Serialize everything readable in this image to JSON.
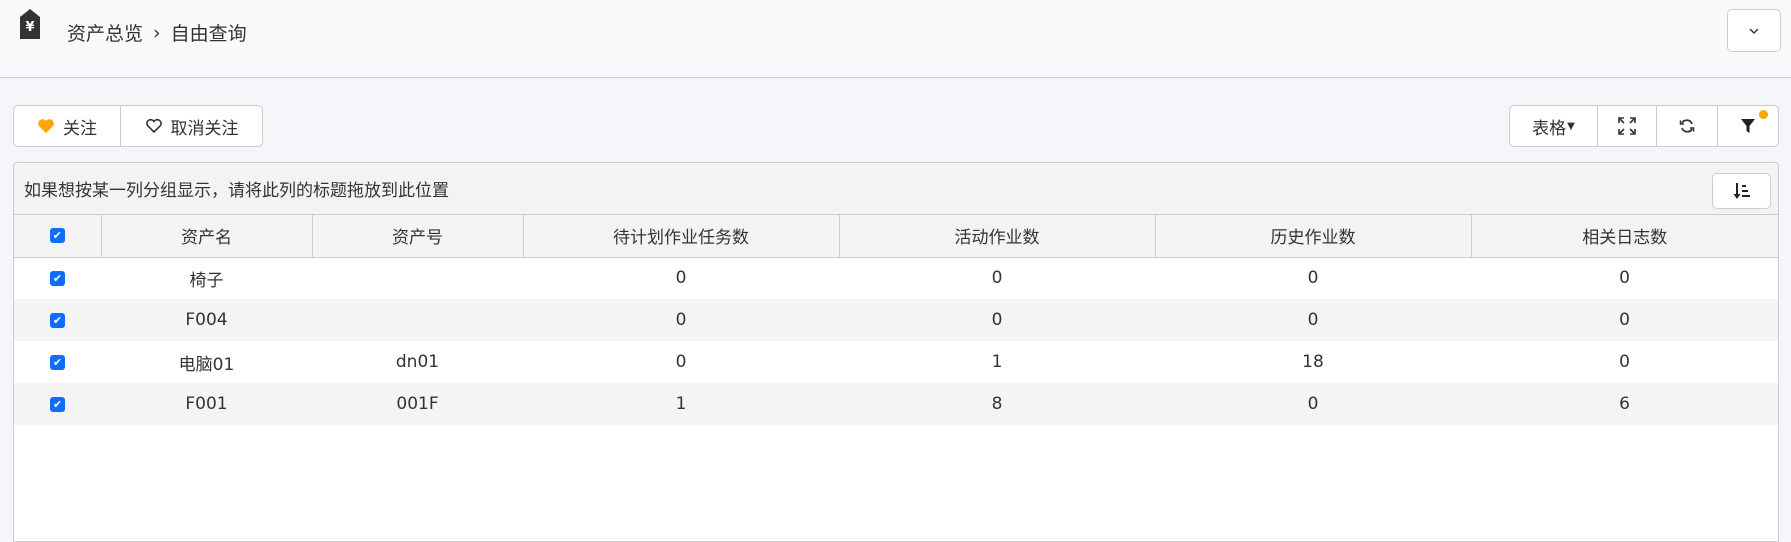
{
  "header": {
    "breadcrumb": [
      "资产总览",
      "自由查询"
    ],
    "separator": "›",
    "dropdown_icon": "chevron-down-icon"
  },
  "actions": {
    "follow": "关注",
    "unfollow": "取消关注",
    "view_mode": "表格",
    "follow_color": "#ffa500"
  },
  "grid": {
    "group_hint": "如果想按某一列分组显示，请将此列的标题拖放到此位置",
    "columns": [
      "资产名",
      "资产号",
      "待计划作业任务数",
      "活动作业数",
      "历史作业数",
      "相关日志数"
    ],
    "rows": [
      [
        "椅子",
        "",
        "0",
        "0",
        "0",
        "0"
      ],
      [
        "F004",
        "",
        "0",
        "0",
        "0",
        "0"
      ],
      [
        "电脑01",
        "dn01",
        "0",
        "1",
        "18",
        "0"
      ],
      [
        "F001",
        "001F",
        "1",
        "8",
        "0",
        "6"
      ]
    ],
    "all_checked": true,
    "checkbox_color": "#0d6efd"
  }
}
